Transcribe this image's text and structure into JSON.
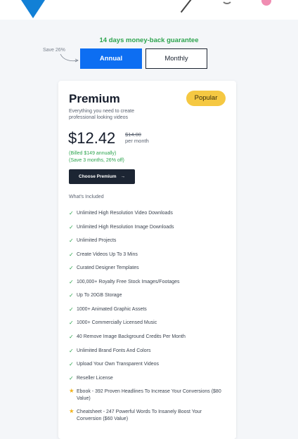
{
  "guarantee": "14 days money-back guarantee",
  "save_note": "Save 26%",
  "toggle": {
    "annual": "Annual",
    "monthly": "Monthly"
  },
  "plan": {
    "name": "Premium",
    "badge": "Popular",
    "description": "Everything you need to create professional looking videos",
    "price": "$12.42",
    "old_price": "$14.00",
    "period": "per month",
    "billed_line1": "(Billed $149 annually)",
    "billed_line2": "(Save 3 months, 26% off)",
    "cta": "Choose Premium",
    "cta_arrow": "→",
    "included_heading": "What's Included"
  },
  "features": [
    {
      "icon": "check-icon",
      "text": "Unlimited High Resolution Video Downloads"
    },
    {
      "icon": "check-icon",
      "text": "Unlimited High Resolution Image Downloads"
    },
    {
      "icon": "check-icon",
      "text": "Unlimited Projects"
    },
    {
      "icon": "check-icon",
      "text": "Create Videos Up To 3 Mins"
    },
    {
      "icon": "check-icon",
      "text": "Curated Designer Templates"
    },
    {
      "icon": "check-icon",
      "text": "100,000+ Royalty Free Stock Images/Footages"
    },
    {
      "icon": "check-icon",
      "text": "Up To 20GB Storage"
    },
    {
      "icon": "check-icon",
      "text": "1000+ Animated Graphic Assets"
    },
    {
      "icon": "check-icon",
      "text": "1000+ Commercially Licensed Music"
    },
    {
      "icon": "check-icon",
      "text": "40 Remove Image Background Credits Per Month"
    },
    {
      "icon": "check-icon",
      "text": "Unlimited Brand Fonts And Colors"
    },
    {
      "icon": "check-icon",
      "text": "Upload Your Own Transparent Videos"
    },
    {
      "icon": "check-icon",
      "text": "Reseller License"
    },
    {
      "icon": "star-icon",
      "text": "Ebook - 392 Proven Headlines To Increase Your Conversions ($80 Value)"
    },
    {
      "icon": "star-icon",
      "text": "Cheatsheet - 247 Powerful Words To Insanely Boost Your Conversion ($60 Value)"
    }
  ],
  "colors": {
    "accent_blue": "#0d6ef2",
    "green": "#2da44e",
    "badge_yellow": "#f5c842",
    "dark_button": "#1c2533",
    "star": "#f2b31a"
  }
}
